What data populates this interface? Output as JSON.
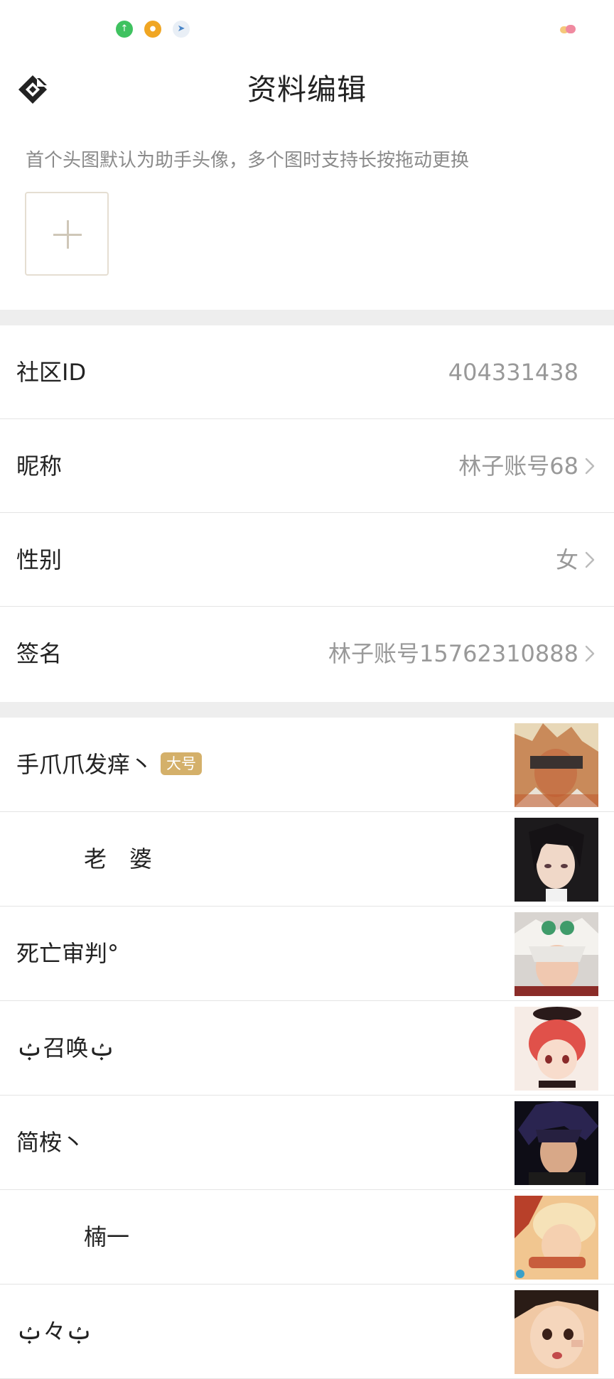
{
  "status_bar": {
    "icons": [
      "upload-icon",
      "coin-icon",
      "send-icon"
    ],
    "colors": {
      "green": "#3fc260",
      "orange": "#f0a623",
      "send": "#4a86c8"
    }
  },
  "header": {
    "title": "资料编辑",
    "back_icon": "diamond-logo-icon"
  },
  "avatar_section": {
    "hint": "首个头图默认为助手头像，多个图时支持长按拖动更换",
    "add_icon": "plus-icon"
  },
  "profile": {
    "rows": [
      {
        "label": "社区ID",
        "value": "404331438"
      },
      {
        "label": "昵称",
        "value": "林子账号68"
      },
      {
        "label": "性别",
        "value": "女"
      },
      {
        "label": "签名",
        "value": "林子账号15762310888"
      }
    ]
  },
  "accounts": {
    "badge": "大号",
    "items": [
      {
        "name": "手爪爪发痒丶"
      },
      {
        "name": "老　婆"
      },
      {
        "name": "死亡审判°"
      },
      {
        "name": "ࢶ召唤ࢶ"
      },
      {
        "name": "简桉丶"
      },
      {
        "name": "楠一"
      },
      {
        "name": "ࢶ々ࢶ"
      }
    ]
  },
  "colors": {
    "accent_badge": "#d4b06a",
    "divider": "#e4e4e4",
    "section_bg": "#eeeeee",
    "value_text": "#999999"
  }
}
